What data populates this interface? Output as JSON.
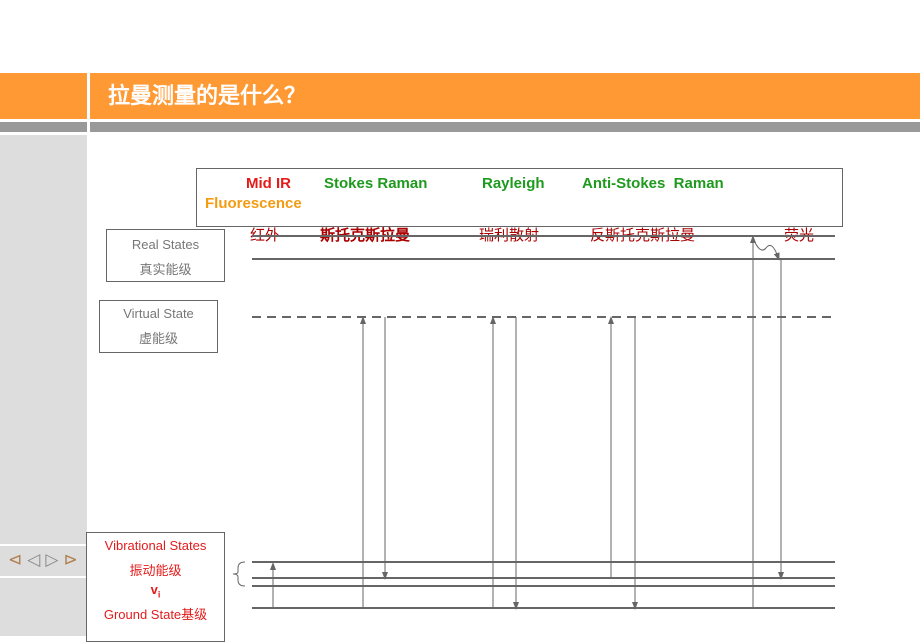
{
  "header": {
    "title": "拉曼测量的是什么？"
  },
  "nav": {
    "first": "⊲",
    "prev": "◁",
    "next": "▷",
    "last": "⊳"
  },
  "legend": {
    "mid_ir": "Mid IR",
    "stokes": "Stokes Raman",
    "rayleigh": "Rayleigh",
    "anti_stokes": "Anti-Stokes  Raman",
    "fluorescence": "Fluorescence"
  },
  "labels_cn": {
    "mid_ir": "红外",
    "stokes": "斯托克斯拉曼",
    "rayleigh": "瑞利散射",
    "anti_stokes": "反斯托克斯拉曼",
    "fluorescence": "荧光"
  },
  "states": {
    "real_en": "Real States",
    "real_cn": "真实能级",
    "virtual_en": "Virtual State",
    "virtual_cn": "虚能级",
    "vib_en": "Vibrational States",
    "vib_cn": "振动能级",
    "vib_symbol": "v",
    "vib_sub": "i",
    "ground": "Ground State基级"
  },
  "colors": {
    "orange": "#FF9933",
    "red": "#E31B1B",
    "green": "#1E9A1E",
    "fluor": "#F39C12",
    "cn_red": "#AA0000"
  }
}
